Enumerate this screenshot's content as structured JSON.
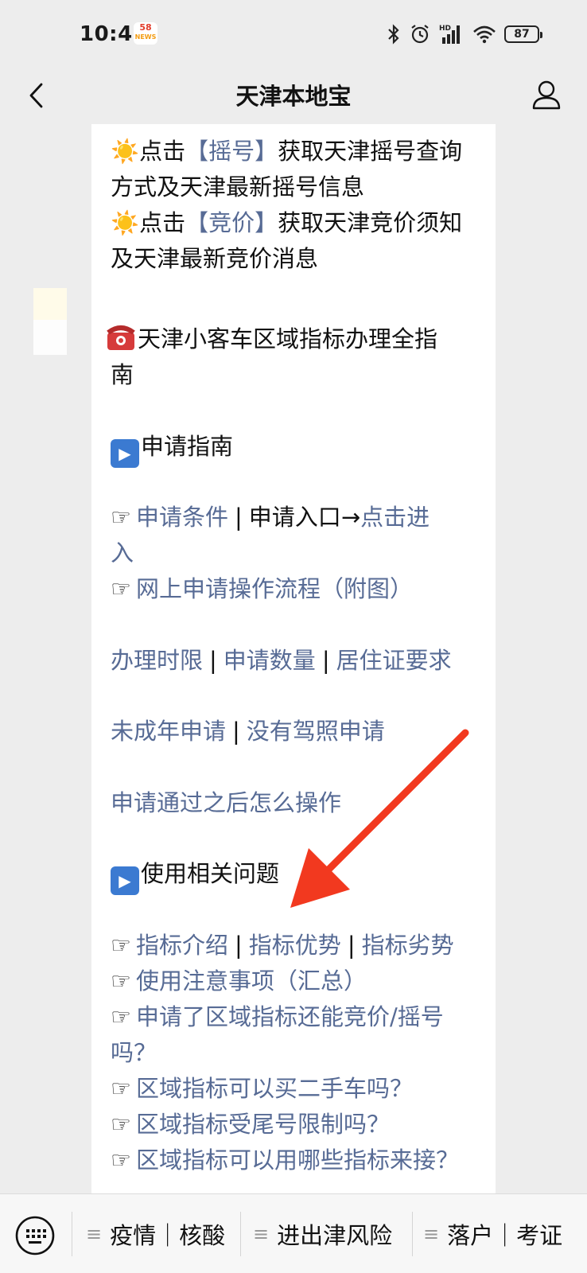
{
  "status": {
    "time": "10:49",
    "app_icon": "58",
    "app_icon_sub": "NEWS",
    "battery": "87",
    "icons": [
      "bluetooth-icon",
      "alarm-icon",
      "hd-signal-icon",
      "wifi-icon",
      "battery-icon"
    ]
  },
  "nav": {
    "title": "天津本地宝",
    "back_icon": "chevron-left-icon",
    "profile_icon": "person-icon"
  },
  "card_top": {
    "line1_prefix": "点击",
    "line1_link": "【摇号】",
    "line1_suffix": "获取天津摇号查询",
    "line2": "方式及天津最新摇号信息",
    "line3_prefix": "点击",
    "line3_link": "【竞价】",
    "line3_suffix": "获取天津竞价须知",
    "line4": "及天津最新竞价消息"
  },
  "card_main": {
    "title_line1": "天津小客车区域指标办理全指",
    "title_line2": "南",
    "section1": "申请指南",
    "apply_conditions": "申请条件",
    "apply_entry": "申请入口",
    "arrow_text": "→",
    "click_enter": "点击进",
    "click_enter2": "入",
    "online_flow": "网上申请操作流程（附图）",
    "time_limit": "办理时限",
    "apply_count": "申请数量",
    "residence": "居住证要求",
    "minor": "未成年申请",
    "no_license": "没有驾照申请",
    "after_pass": "申请通过之后怎么操作",
    "section2": "使用相关问题",
    "intro": "指标介绍",
    "advantage": "指标优势",
    "disadvantage": "指标劣势",
    "notes": "使用注意事项（汇总）",
    "q1_line1": "申请了区域指标还能竞价/摇号",
    "q1_line2": "吗？",
    "q2": "区域指标可以买二手车吗？",
    "q3": "区域指标受尾号限制吗？",
    "q4": "区域指标可以用哪些指标来接？",
    "separator": "|",
    "finger": "☞",
    "play": "▶"
  },
  "bottom_menu": {
    "keyboard_icon": "keyboard-icon",
    "items": [
      {
        "label": "疫情｜核酸"
      },
      {
        "label": "进出津风险"
      },
      {
        "label": "落户｜考证"
      }
    ]
  }
}
